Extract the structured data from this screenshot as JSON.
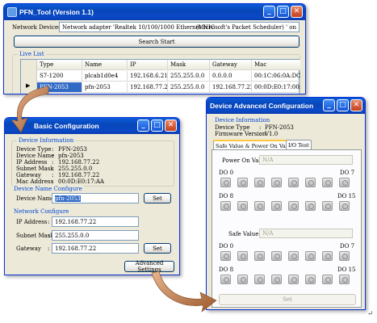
{
  "main_window": {
    "title": "PFN_Tool (Version 1.1)",
    "network_devices_label": "Network Devices :",
    "network_adapter": "Network adapter 'Realtek 10/100/1000 Ethernet NIC",
    "network_adapter_suffix": "(Microsoft's Packet Scheduler) ' on",
    "search_button": "Search Start",
    "live_list_label": "Live List",
    "table": {
      "headers": [
        "Type",
        "Name",
        "IP",
        "Mask",
        "Gateway",
        "Mac"
      ],
      "rows": [
        [
          "S7-1200",
          "plcab1d0e4",
          "192.168.6.211",
          "255.255.0.0",
          "0.0.0.0",
          "00:1C:06:0A:DC:..."
        ],
        [
          "PFN-2053",
          "pfn-2053",
          "192.168.77.22",
          "255.255.0.0",
          "192.168.77.22",
          "00:0D:E0:17:00:AA"
        ]
      ],
      "selected_row": 1
    }
  },
  "basic_window": {
    "title": "Device Basic Configuration",
    "title_visible": "Basic Configuration",
    "info_group_label": "Device Information",
    "info": [
      {
        "label": "Device Type",
        "value": "PFN-2053"
      },
      {
        "label": "Device Name",
        "value": "pfn-2053"
      },
      {
        "label": "IP Address",
        "value": "192.168.77.22"
      },
      {
        "label": "Subnet Mask",
        "value": "255.255.0.0"
      },
      {
        "label": "Gateway",
        "value": "192.168.77.22"
      },
      {
        "label": "Mac Address",
        "value": "00:0D:E0:17:AA"
      }
    ],
    "name_group_label": "Device Name Configure",
    "device_name_label": "Device Name :",
    "device_name_value": "pfn-2053",
    "set_name_button": "Set",
    "network_group_label": "Network Configure",
    "ip_label": "IP Address",
    "ip_value": "192.168.77.22",
    "mask_label": "Subnet Mask",
    "mask_value": "255.255.0.0",
    "gateway_label": "Gateway",
    "gateway_value": "192.168.77.22",
    "set_network_button": "Set",
    "advanced_button": "Advanced Settings"
  },
  "advanced_window": {
    "title": "Device Advanced Configuration",
    "info_group_label": "Device Information",
    "device_type_label": "Device Type",
    "device_type_value": "PFN-2053",
    "firmware_label": "Firmware Version",
    "firmware_value": "V1.0",
    "tabs": [
      "Safe Value & Power On Value",
      "I/O Test"
    ],
    "power_on_label": "Power On Value :",
    "power_on_value": "N/A",
    "do0": "DO 0",
    "do7": "DO 7",
    "do8": "DO 8",
    "do15": "DO 15",
    "safe_label": "Safe Value :",
    "safe_value": "N/A",
    "set_button": "Set"
  },
  "colon": ":",
  "return_mark": "↵",
  "colors": {
    "title_bar": "#0a49c7",
    "selection": "#316ac5",
    "group_title": "#0046d5",
    "arrow": "#b36a3a"
  }
}
